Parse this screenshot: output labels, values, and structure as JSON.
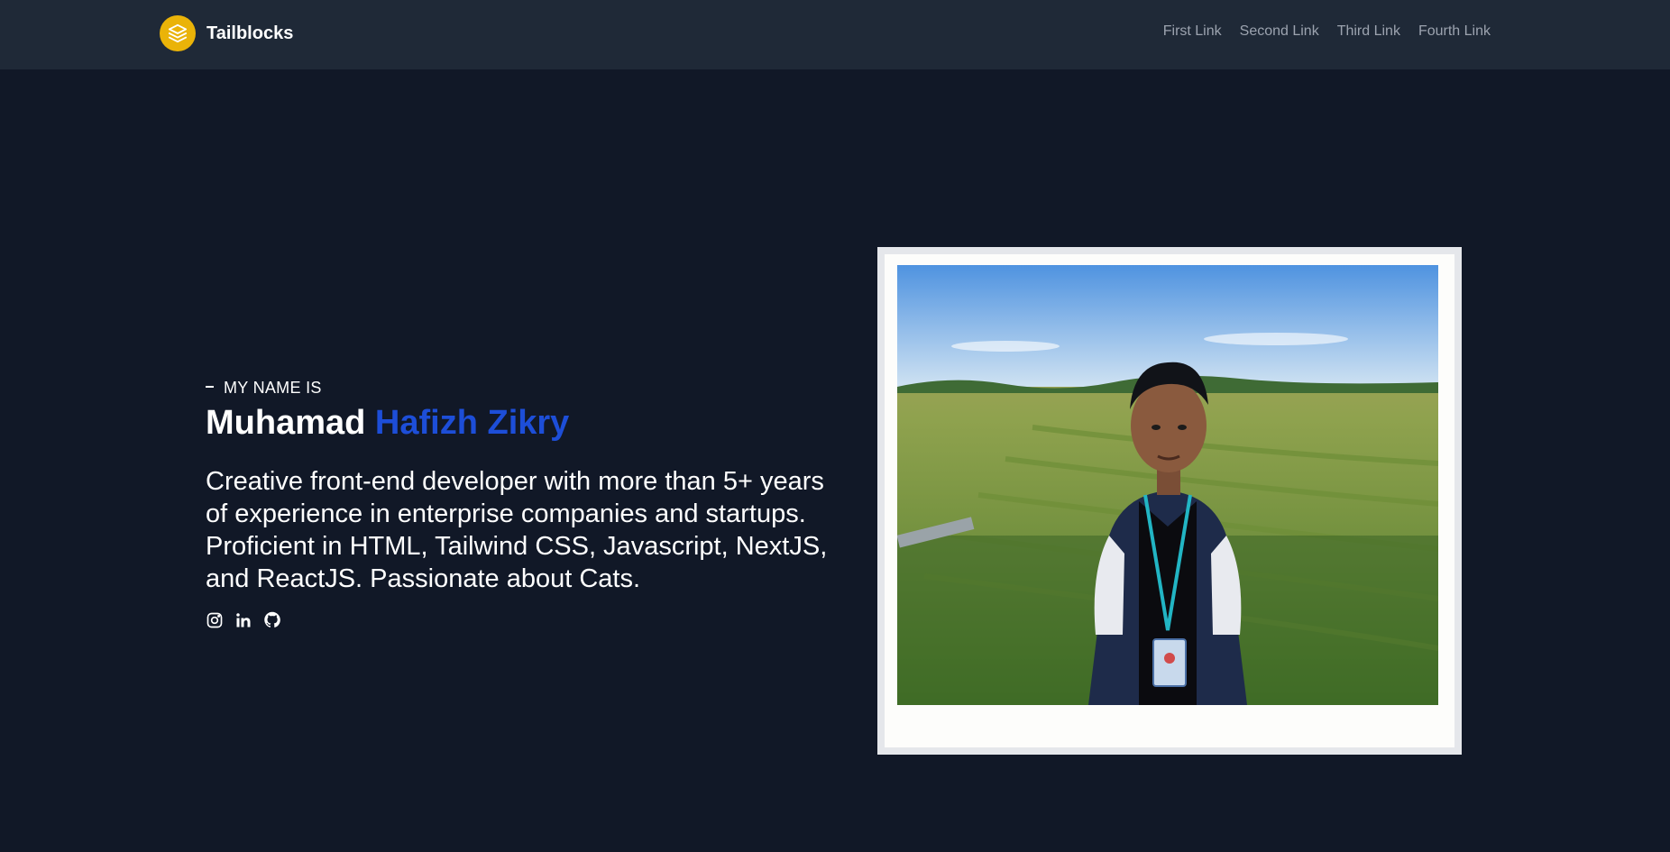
{
  "brand": {
    "name": "Tailblocks",
    "icon": "stack-layers-icon",
    "color": "#eab308"
  },
  "nav": {
    "links": [
      {
        "label": "First Link"
      },
      {
        "label": "Second Link"
      },
      {
        "label": "Third Link"
      },
      {
        "label": "Fourth Link"
      }
    ]
  },
  "hero": {
    "eyebrow": "MY NAME IS",
    "first_name": "Muhamad",
    "last_name": "Hafizh Zikry",
    "bio": "Creative front-end developer with more than 5+ years of experience in enterprise companies and startups. Proficient in HTML, Tailwind CSS, Javascript, NextJS, and ReactJS. Passionate about Cats.",
    "accent_color": "#1d4ed8",
    "socials": [
      {
        "icon": "instagram-icon"
      },
      {
        "icon": "linkedin-icon"
      },
      {
        "icon": "github-icon"
      }
    ]
  },
  "photo": {
    "subject": "portrait-photo"
  }
}
